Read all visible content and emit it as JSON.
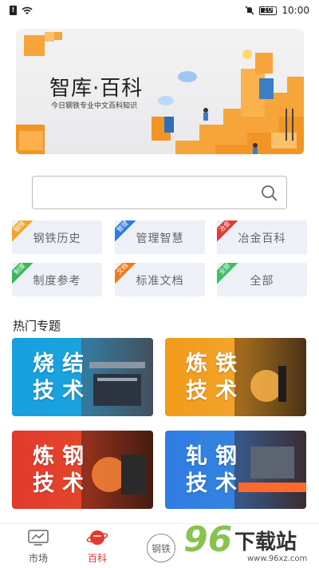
{
  "status_bar": {
    "time": "10:00",
    "battery": "100",
    "warning": "!"
  },
  "banner": {
    "title": "智库·百科",
    "subtitle": "今日钢铁专业中文百科知识"
  },
  "search": {
    "placeholder": ""
  },
  "categories": [
    {
      "label": "钢铁历史",
      "tag": "钢铁",
      "tag_color": "#f3a52a"
    },
    {
      "label": "管理智慧",
      "tag": "管理",
      "tag_color": "#2f7de1"
    },
    {
      "label": "冶金百科",
      "tag": "冶金",
      "tag_color": "#e23a2e"
    },
    {
      "label": "制度参考",
      "tag": "制度",
      "tag_color": "#35b85a"
    },
    {
      "label": "标准文档",
      "tag": "文档",
      "tag_color": "#f07b1e"
    },
    {
      "label": "全部",
      "tag": "全部",
      "tag_color": "#3bbf6a"
    }
  ],
  "section": {
    "title": "热门专题"
  },
  "topics": [
    {
      "line1": "烧结",
      "line2": "技术",
      "color": "#1aa3df"
    },
    {
      "line1": "炼铁",
      "line2": "技术",
      "color": "#f29b1a"
    },
    {
      "line1": "炼钢",
      "line2": "技术",
      "color": "#e23a2e"
    },
    {
      "line1": "轧钢",
      "line2": "技术",
      "color": "#2f7de1"
    }
  ],
  "nav": [
    {
      "label": "市场",
      "icon": "monitor-chart-icon"
    },
    {
      "label": "百科",
      "icon": "planet-icon"
    },
    {
      "label": "钢铁",
      "icon": "steel-circle-icon"
    }
  ],
  "watermark": {
    "brand": "96",
    "text": "下载站",
    "url": "www.96xz.com"
  }
}
